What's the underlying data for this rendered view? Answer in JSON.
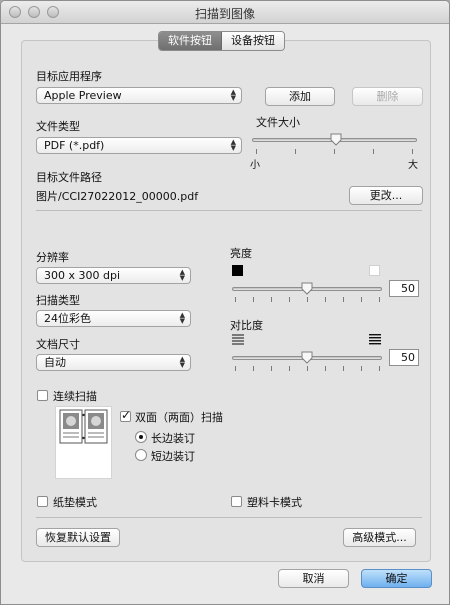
{
  "window": {
    "title": "扫描到图像"
  },
  "tabs": [
    {
      "label": "软件按钮",
      "selected": true
    },
    {
      "label": "设备按钮",
      "selected": false
    }
  ],
  "target_app": {
    "label": "目标应用程序",
    "value": "Apple Preview",
    "add": "添加",
    "remove": "删除"
  },
  "file_type": {
    "label": "文件类型",
    "value": "PDF (*.pdf)"
  },
  "file_size": {
    "label": "文件大小",
    "min_label": "小",
    "max_label": "大",
    "level": 0.55
  },
  "dest_path": {
    "label": "目标文件路径",
    "value": "图片/CCI27022012_00000.pdf",
    "change": "更改..."
  },
  "resolution": {
    "label": "分辨率",
    "value": "300 x 300 dpi"
  },
  "scan_type": {
    "label": "扫描类型",
    "value": "24位彩色"
  },
  "doc_size": {
    "label": "文档尺寸",
    "value": "自动"
  },
  "brightness": {
    "label": "亮度",
    "value": "50"
  },
  "contrast": {
    "label": "对比度",
    "value": "50"
  },
  "continuous": {
    "label": "连续扫描",
    "checked": false
  },
  "duplex": {
    "label": "双面（两面）扫描",
    "checked": true,
    "long_edge": "长边装订",
    "short_edge": "短边装订",
    "selected": "long_edge"
  },
  "carrier_sheet": {
    "label": "纸垫模式",
    "checked": false
  },
  "plastic_card": {
    "label": "塑料卡模式",
    "checked": false
  },
  "buttons": {
    "restore_defaults": "恢复默认设置",
    "advanced": "高级模式...",
    "cancel": "取消",
    "ok": "确定"
  }
}
